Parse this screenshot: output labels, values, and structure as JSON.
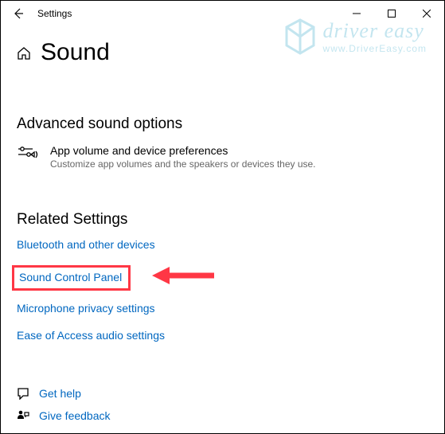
{
  "window": {
    "app_title": "Settings"
  },
  "page": {
    "title": "Sound"
  },
  "advanced": {
    "heading": "Advanced sound options",
    "pref_title": "App volume and device preferences",
    "pref_desc": "Customize app volumes and the speakers or devices they use."
  },
  "related": {
    "heading": "Related Settings",
    "links": {
      "bluetooth": "Bluetooth and other devices",
      "sound_cpl": "Sound Control Panel",
      "mic_privacy": "Microphone privacy settings",
      "ease_audio": "Ease of Access audio settings"
    }
  },
  "footer": {
    "get_help": "Get help",
    "give_feedback": "Give feedback"
  },
  "watermark": {
    "line1": "driver easy",
    "line2": "www.DriverEasy.com"
  },
  "annotation": {
    "highlight_color": "#ff3745"
  }
}
